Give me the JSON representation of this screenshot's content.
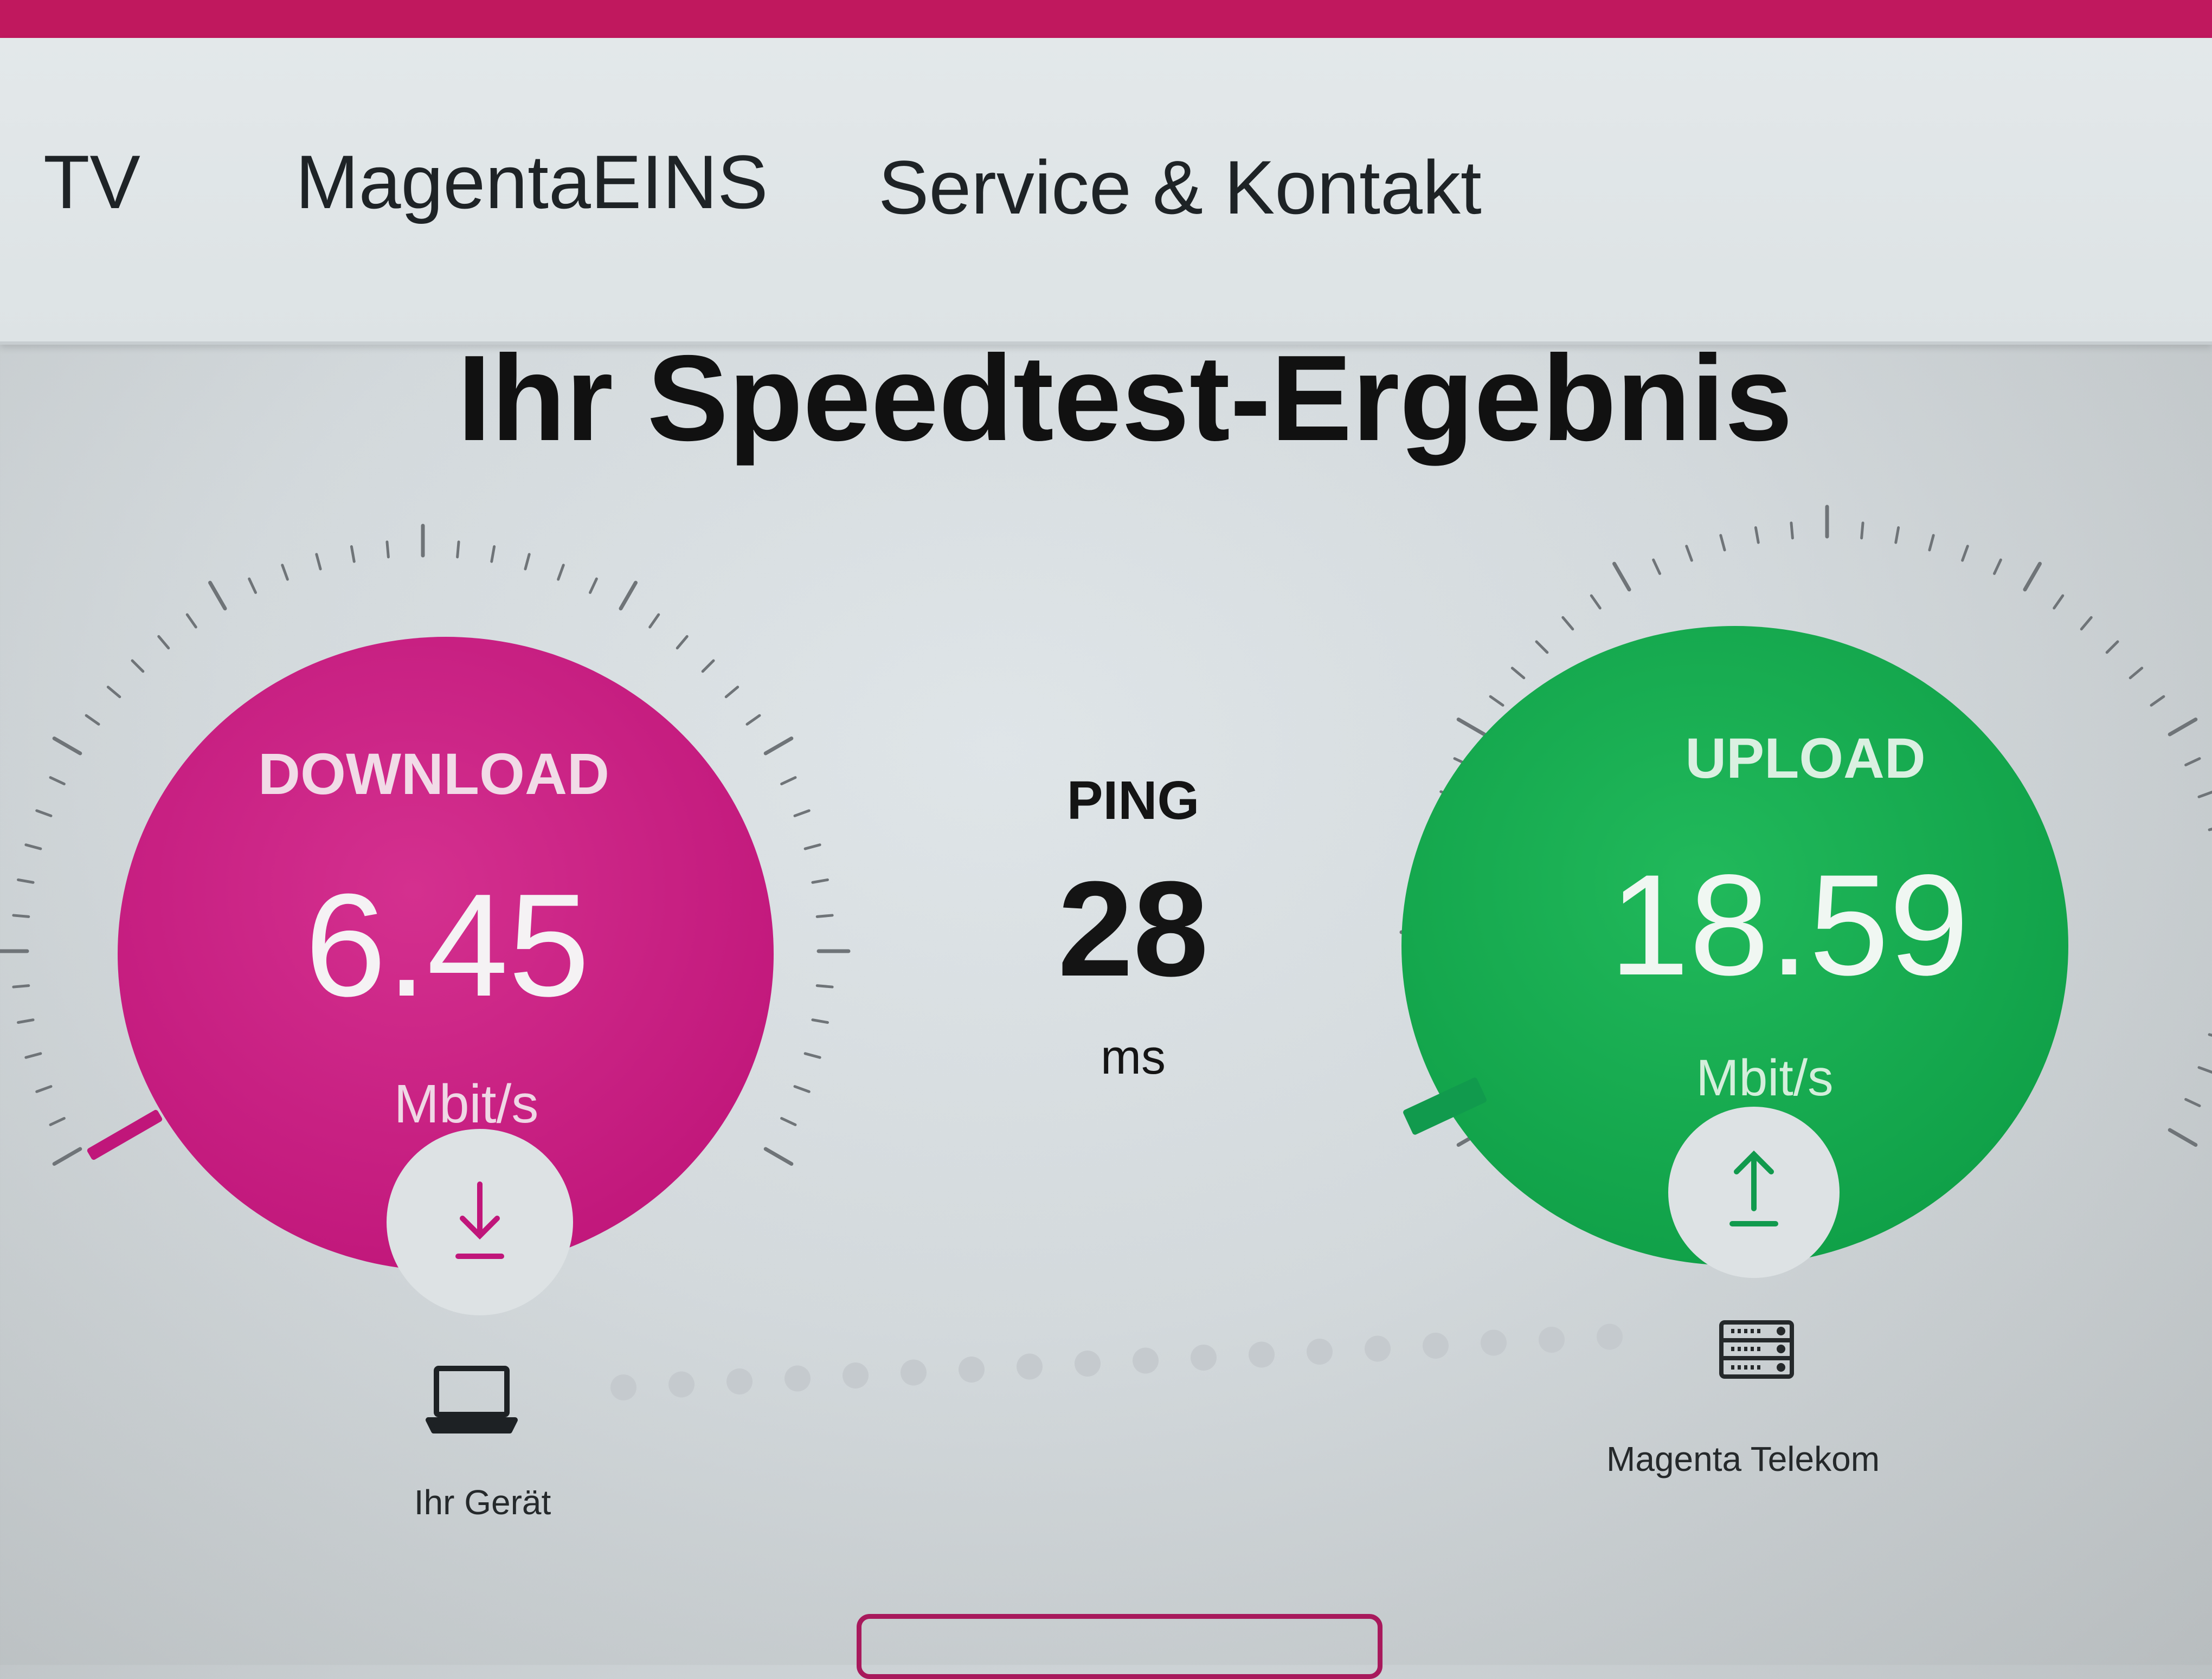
{
  "nav": {
    "items": [
      {
        "label": "TV"
      },
      {
        "label": "MagentaEINS"
      },
      {
        "label": "Service & Kontakt"
      }
    ]
  },
  "page_title": "Ihr Speedtest-Ergebnis",
  "download": {
    "label": "DOWNLOAD",
    "value": "6.45",
    "unit": "Mbit/s"
  },
  "ping": {
    "label": "PING",
    "value": "28",
    "unit": "ms"
  },
  "upload": {
    "label": "UPLOAD",
    "value": "18.59",
    "unit": "Mbit/s"
  },
  "device": {
    "label": "Ihr Gerät"
  },
  "server": {
    "label": "Magenta Telekom"
  },
  "colors": {
    "magenta": "#c8257f",
    "green": "#19b154",
    "brand_bar": "#c0185e"
  },
  "icons": {
    "download": "arrow-down-icon",
    "upload": "arrow-up-icon",
    "device": "laptop-icon",
    "server": "server-icon"
  }
}
